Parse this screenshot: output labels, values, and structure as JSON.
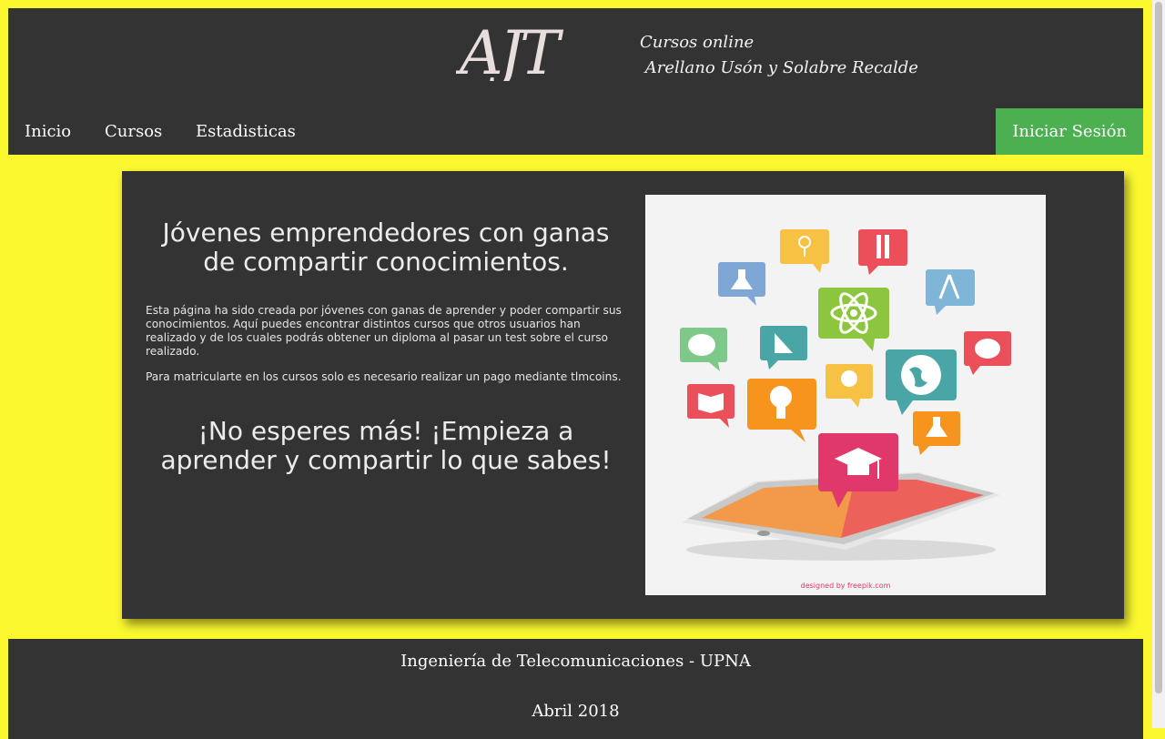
{
  "header": {
    "logo_text": "AJT",
    "tagline_line1": "Cursos online",
    "tagline_line2": " Arellano Usón y Solabre Recalde"
  },
  "nav": {
    "items": [
      "Inicio",
      "Cursos",
      "Estadisticas"
    ],
    "login_label": "Iniciar Sesión"
  },
  "main": {
    "headline": "Jóvenes emprendedores con ganas de compartir conocimientos.",
    "paragraph1": "Esta página ha sido creada por jóvenes con ganas de aprender y poder compartir sus conocimientos. Aquí puedes encontrar distintos cursos que otros usuarios han realizado y de los cuales podrás obtener un diploma al pasar un test sobre el curso realizado.",
    "paragraph2": "Para matricularte en los cursos solo es necesario realizar un pago mediante tlmcoins.",
    "headline2": "¡No esperes más! ¡Empieza a aprender y compartir lo que sabes!",
    "illustration_credit": "designed by freepik.com"
  },
  "footer": {
    "line1": "Ingeniería de Telecomunicaciones - UPNA",
    "line2": "Abril 2018"
  },
  "colors": {
    "page_background": "#fbf830",
    "panel": "#333333",
    "login_button": "#4caf50"
  }
}
